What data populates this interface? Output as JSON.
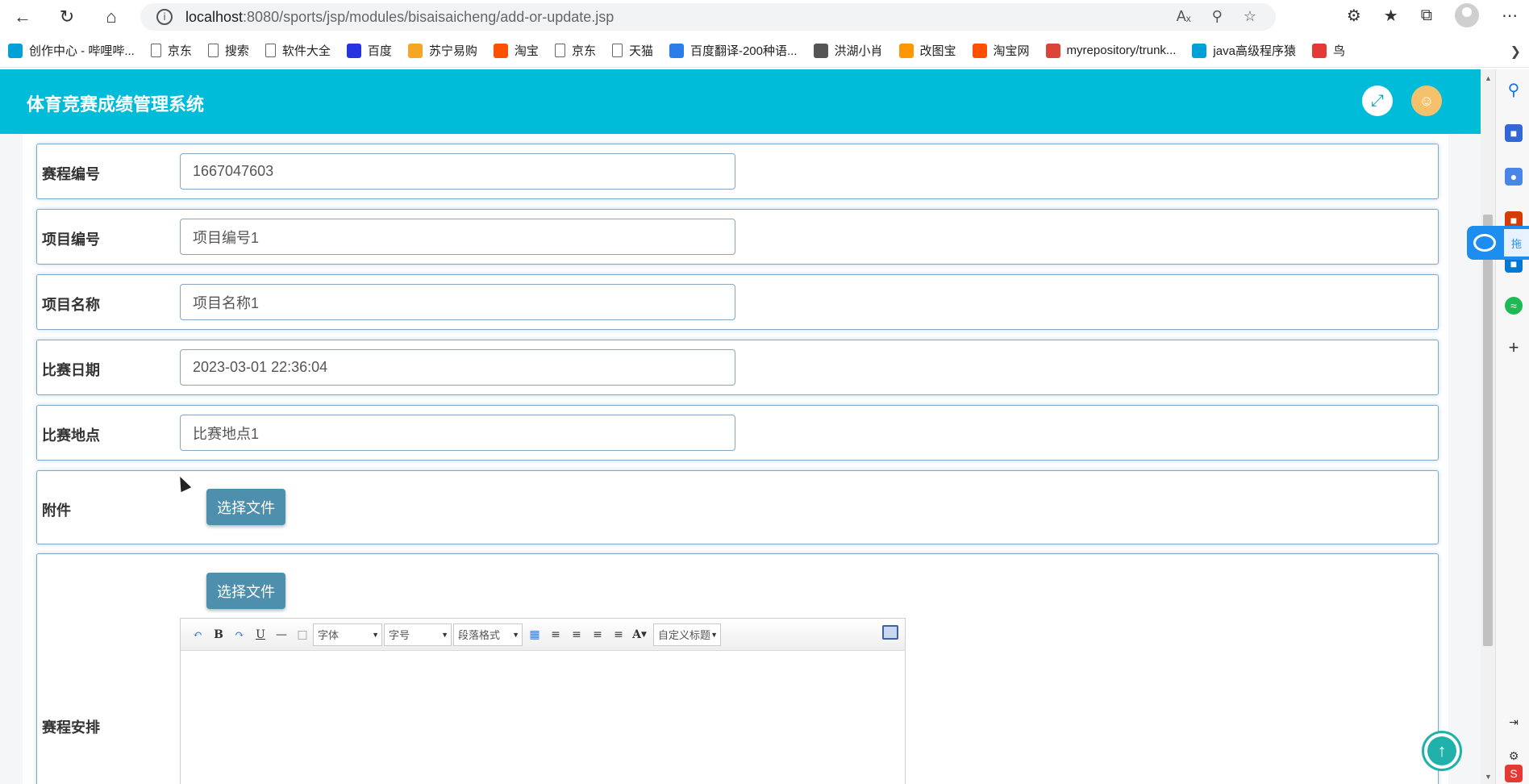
{
  "browser": {
    "url_host": "localhost",
    "url_path": ":8080/sports/jsp/modules/bisaisaicheng/add-or-update.jsp",
    "info_icon": "info-icon"
  },
  "bookmarks": [
    {
      "label": "创作中心 - 哔哩哔...",
      "icon": "bilibili-icon",
      "color": "#00a1d6"
    },
    {
      "label": "京东",
      "icon": "page-icon",
      "color": "#666666"
    },
    {
      "label": "搜索",
      "icon": "page-icon",
      "color": "#666666"
    },
    {
      "label": "软件大全",
      "icon": "page-icon",
      "color": "#666666"
    },
    {
      "label": "百度",
      "icon": "baidu-paw-icon",
      "color": "#2932e1"
    },
    {
      "label": "苏宁易购",
      "icon": "suning-icon",
      "color": "#f5a623"
    },
    {
      "label": "淘宝",
      "icon": "taobao-icon",
      "color": "#ff5000"
    },
    {
      "label": "京东",
      "icon": "page-icon",
      "color": "#666666"
    },
    {
      "label": "天猫",
      "icon": "page-icon",
      "color": "#666666"
    },
    {
      "label": "百度翻译-200种语...",
      "icon": "translate-icon",
      "color": "#2b7de9"
    },
    {
      "label": "洪湖小肖",
      "icon": "bird-icon",
      "color": "#555555"
    },
    {
      "label": "改图宝",
      "icon": "gaitubao-icon",
      "color": "#ff9800"
    },
    {
      "label": "淘宝网",
      "icon": "taobao-icon",
      "color": "#ff5000"
    },
    {
      "label": "myrepository/trunk...",
      "icon": "chrome-icon",
      "color": "#db4437"
    },
    {
      "label": "java高级程序猿",
      "icon": "bilibili-icon",
      "color": "#00a1d6"
    },
    {
      "label": "鸟",
      "icon": "bird-icon",
      "color": "#e53935"
    }
  ],
  "header": {
    "title": "体育竞赛成绩管理系统",
    "fullscreen_icon": "fullscreen-icon",
    "user_icon": "user-icon",
    "accent": "#00bcd9"
  },
  "form": {
    "fields": [
      {
        "label": "赛程编号",
        "value": "1667047603",
        "placeholder": ""
      },
      {
        "label": "项目编号",
        "value": "",
        "placeholder": "项目编号1"
      },
      {
        "label": "项目名称",
        "value": "",
        "placeholder": "项目名称1"
      },
      {
        "label": "比赛日期",
        "value": "2023-03-01 22:36:04",
        "placeholder": ""
      },
      {
        "label": "比赛地点",
        "value": "",
        "placeholder": "比赛地点1"
      }
    ],
    "attachment": {
      "label": "附件",
      "button": "选择文件"
    },
    "schedule": {
      "label": "赛程安排",
      "button": "选择文件"
    }
  },
  "editor": {
    "font_select": "字体",
    "size_select": "字号",
    "paragraph_select": "段落格式",
    "custom_title_select": "自定义标题",
    "bold": "B",
    "underline": "U",
    "font_color": "A"
  },
  "floating": {
    "baidu_tab": "拖"
  }
}
